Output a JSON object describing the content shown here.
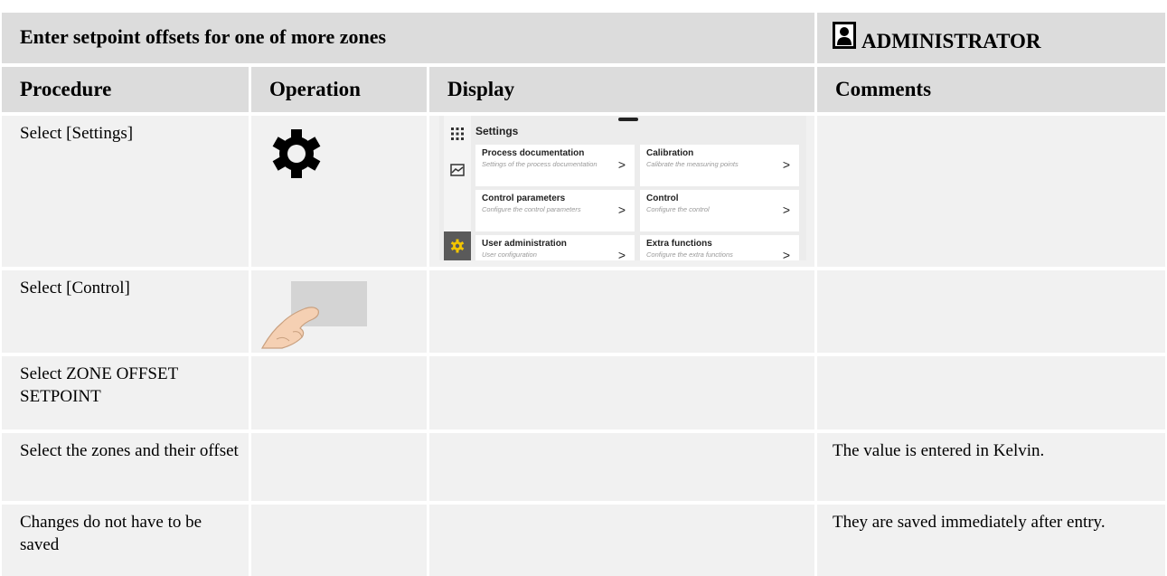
{
  "title_bar": {
    "title": "Enter setpoint offsets for one of more zones",
    "role": "ADMINISTRATOR"
  },
  "columns": {
    "procedure": "Procedure",
    "operation": "Operation",
    "display": "Display",
    "comments": "Comments"
  },
  "rows": [
    {
      "procedure": "Select [Settings]",
      "comment": ""
    },
    {
      "procedure": "Select [Control]",
      "comment": ""
    },
    {
      "procedure": "Select ZONE OFFSET SETPOINT",
      "comment": ""
    },
    {
      "procedure": "Select the zones and their offset",
      "comment": "The value is entered in Kelvin."
    },
    {
      "procedure": "Changes do not have to be saved",
      "comment": "They are saved immediately after entry."
    }
  ],
  "settings_screen": {
    "title": "Settings",
    "tiles": [
      {
        "title": "Process documentation",
        "subtitle": "Settings of the process documentation"
      },
      {
        "title": "Calibration",
        "subtitle": "Calibrate the measuring points"
      },
      {
        "title": "Control parameters",
        "subtitle": "Configure the control parameters"
      },
      {
        "title": "Control",
        "subtitle": "Configure the control"
      },
      {
        "title": "User administration",
        "subtitle": "User configuration"
      },
      {
        "title": "Extra functions",
        "subtitle": "Configure the extra functions"
      }
    ],
    "chevron": ">",
    "icons": [
      "grid-icon",
      "chart-icon",
      "gear-icon"
    ],
    "active_color": "#f2c500"
  },
  "operation_icons": [
    "gear-icon",
    "finger-tap-icon"
  ],
  "colors": {
    "header_bg": "#dcdcdc",
    "cell_bg": "#f1f1f1"
  }
}
